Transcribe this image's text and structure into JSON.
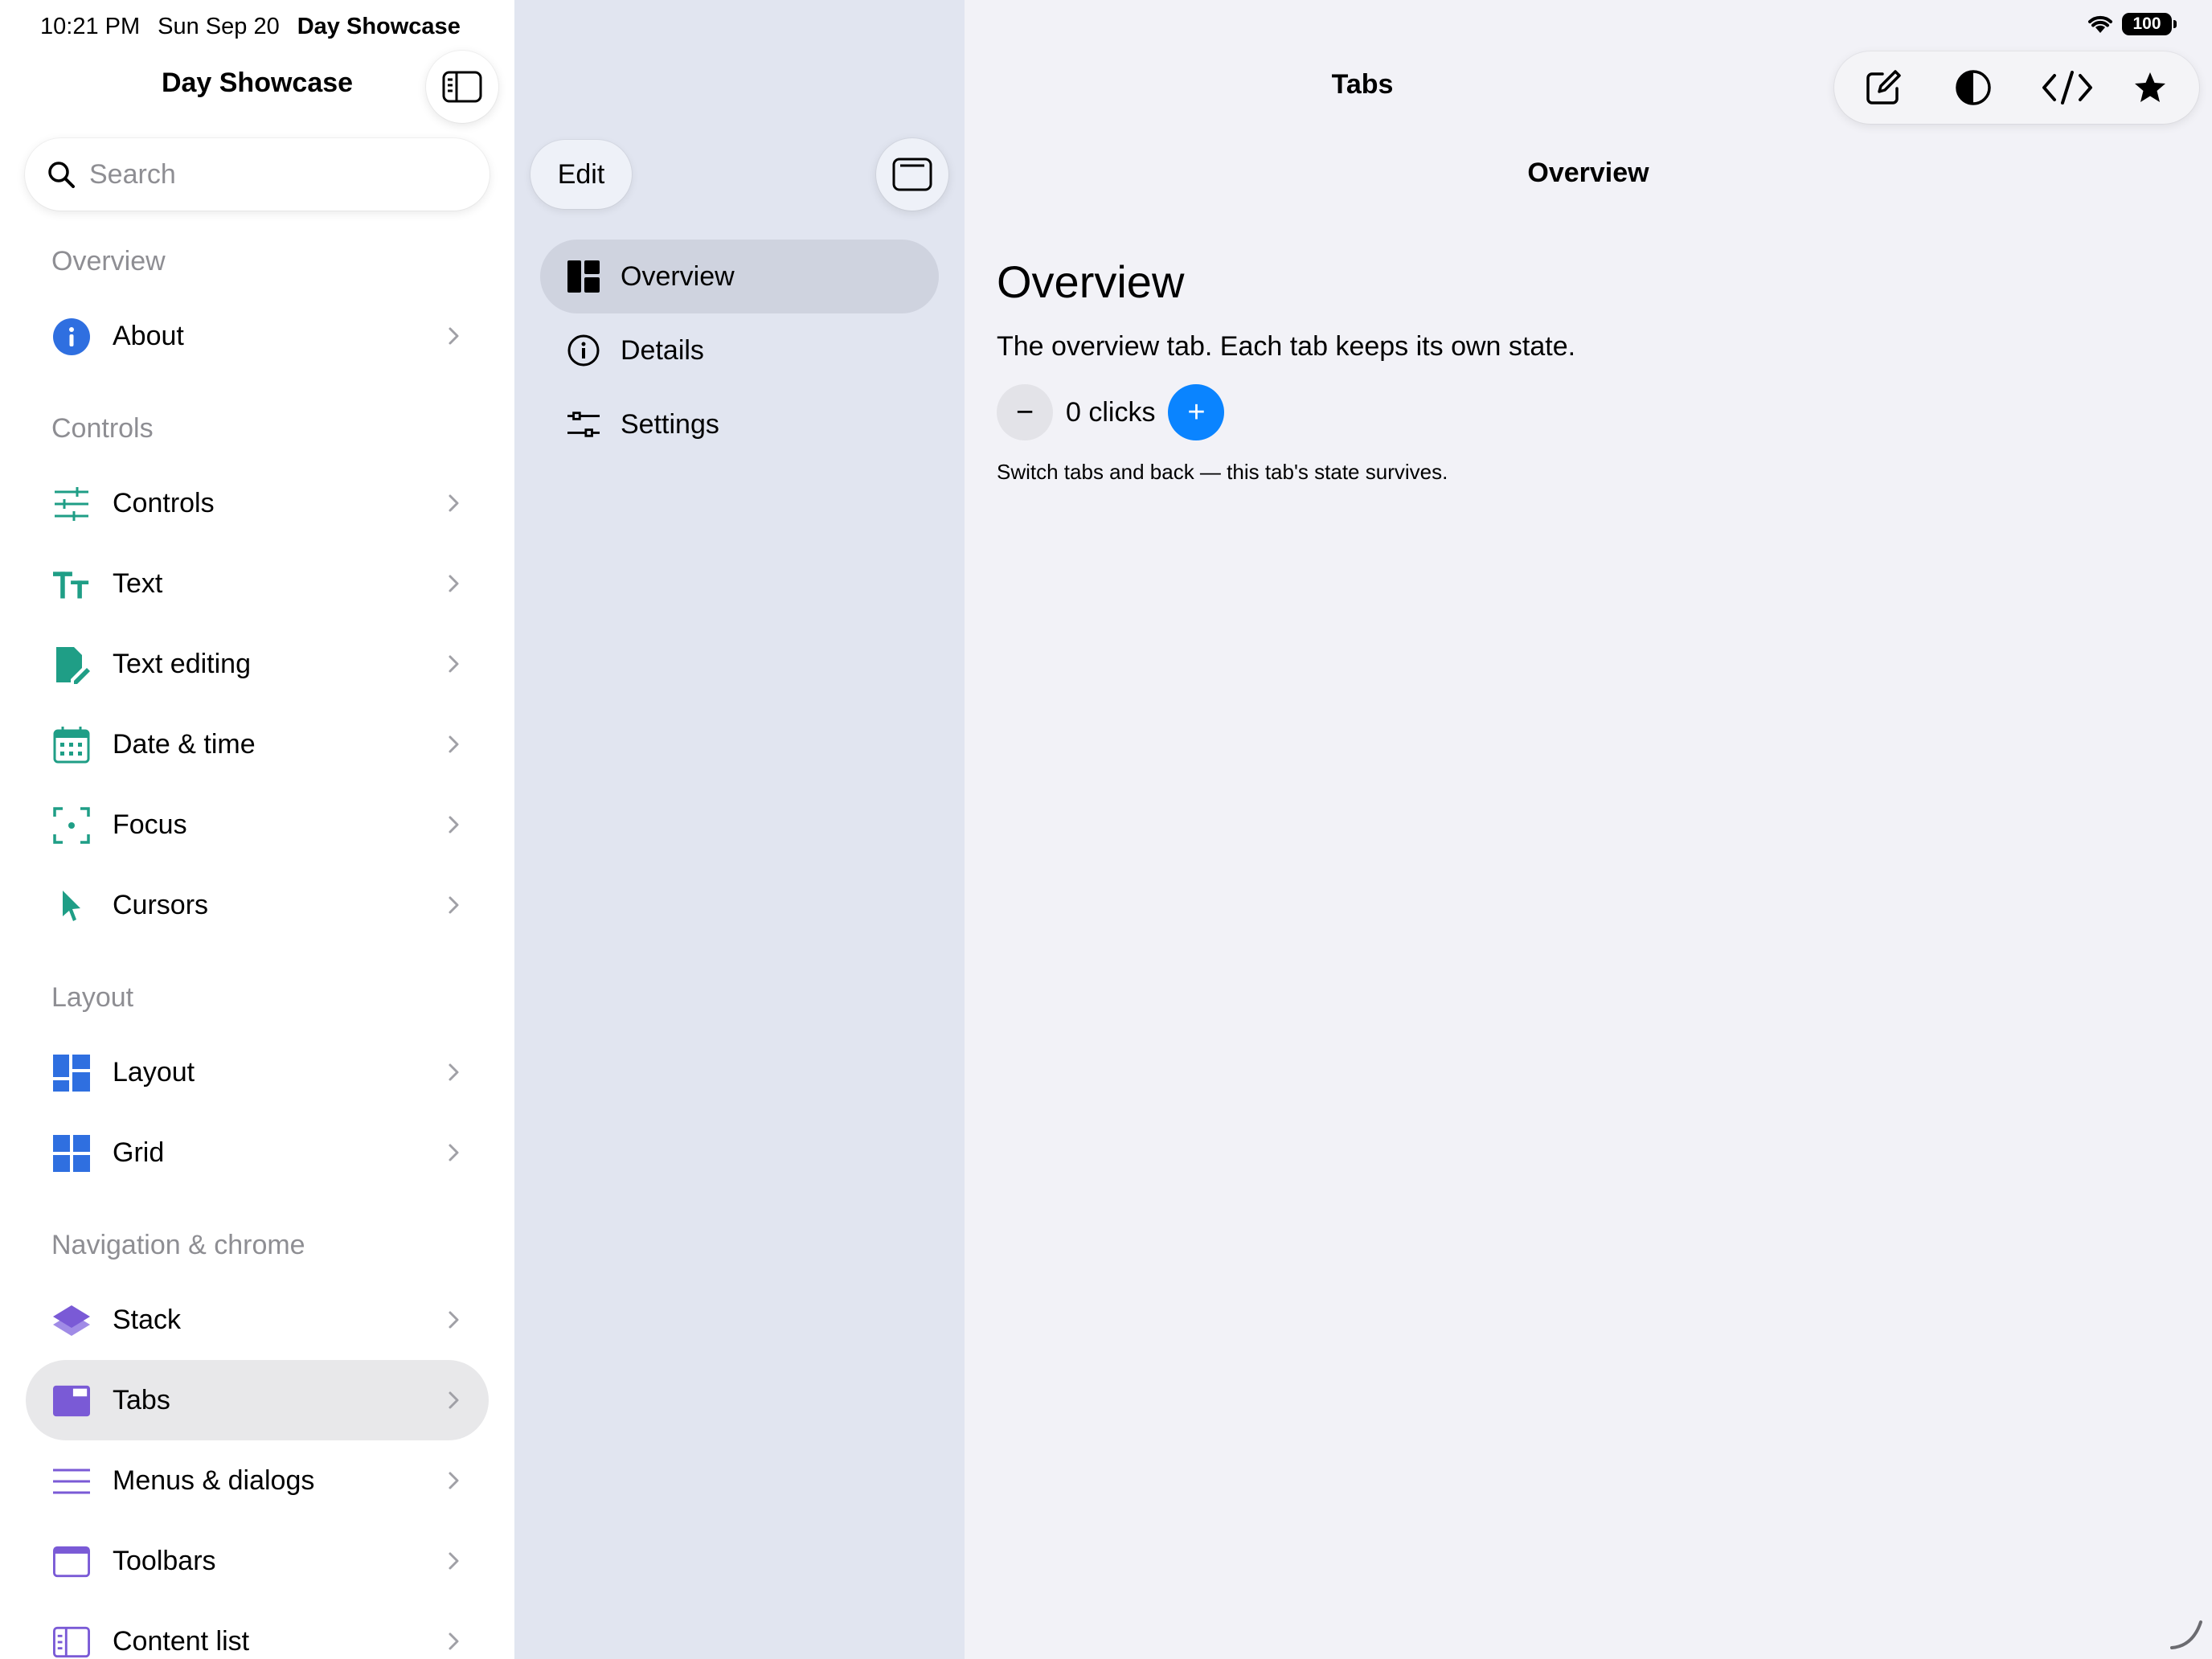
{
  "status_bar": {
    "time": "10:21 PM",
    "date": "Sun Sep 20",
    "app_name": "Day Showcase",
    "battery": "100"
  },
  "sidebar": {
    "title": "Day Showcase",
    "search_placeholder": "Search",
    "sections": {
      "overview": "Overview",
      "controls": "Controls",
      "layout": "Layout",
      "navigation": "Navigation & chrome"
    },
    "items": {
      "about": "About",
      "controls": "Controls",
      "text": "Text",
      "text_editing": "Text editing",
      "date_time": "Date & time",
      "focus": "Focus",
      "cursors": "Cursors",
      "layout": "Layout",
      "grid": "Grid",
      "stack": "Stack",
      "tabs": "Tabs",
      "menus_dialogs": "Menus & dialogs",
      "toolbars": "Toolbars",
      "content_list": "Content list"
    },
    "selected": "tabs",
    "colors": {
      "blue": "#2f6fe0",
      "teal": "#1f9e86",
      "purple": "#7a5ad6"
    }
  },
  "tab_list": {
    "edit_label": "Edit",
    "items": [
      "Overview",
      "Details",
      "Settings"
    ],
    "selected_index": 0
  },
  "detail": {
    "nav_title": "Tabs",
    "subtitle": "Overview",
    "heading": "Overview",
    "description": "The overview tab. Each tab keeps its own state.",
    "minus_label": "−",
    "plus_label": "+",
    "clicks_text": "0 clicks",
    "note": "Switch tabs and back — this tab's state survives.",
    "accent": "#0a84ff"
  },
  "toolbar": {
    "icons": [
      "compose-icon",
      "contrast-icon",
      "code-icon",
      "star-icon"
    ]
  }
}
